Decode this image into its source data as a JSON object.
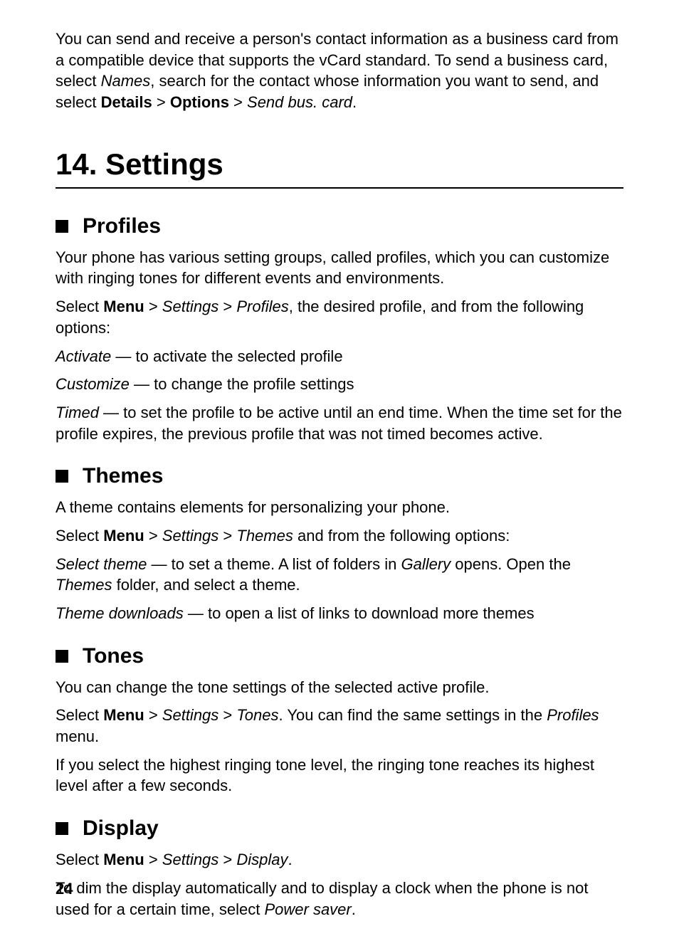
{
  "intro": {
    "text_before_names": "You can send and receive a person's contact information as a business card from a compatible device that supports the vCard standard. To send a business card, select ",
    "names": "Names",
    "text_after_names": ", search for the contact whose information you want to send, and select ",
    "details": "Details",
    "gt1": " > ",
    "options": "Options",
    "gt2": " > ",
    "send_bus_card": "Send bus. card",
    "period": "."
  },
  "chapter": {
    "title": "14. Settings"
  },
  "profiles": {
    "heading": "Profiles",
    "p1": "Your phone has various setting groups, called profiles, which you can customize with ringing tones for different events and environments.",
    "p2_select": "Select ",
    "p2_menu": "Menu",
    "p2_gt1": " > ",
    "p2_settings": "Settings",
    "p2_gt2": " > ",
    "p2_profiles": "Profiles",
    "p2_rest": ", the desired profile, and from the following options:",
    "activate": "Activate",
    "activate_text": " — to activate the selected profile",
    "customize": "Customize",
    "customize_text": " — to change the profile settings",
    "timed": "Timed",
    "timed_text": " — to set the profile to be active until an end time. When the time set for the profile expires, the previous profile that was not timed becomes active."
  },
  "themes": {
    "heading": "Themes",
    "p1": "A theme contains elements for personalizing your phone.",
    "p2_select": "Select ",
    "p2_menu": "Menu",
    "p2_gt1": " > ",
    "p2_settings": "Settings",
    "p2_gt2": " > ",
    "p2_themes": "Themes",
    "p2_rest": " and from the following options:",
    "select_theme": "Select theme",
    "select_theme_text1": " — to set a theme. A list of folders in ",
    "gallery": "Gallery",
    "select_theme_text2": " opens. Open the ",
    "themes_folder": "Themes",
    "select_theme_text3": " folder, and select a theme.",
    "theme_downloads": "Theme downloads",
    "theme_downloads_text": " — to open a list of links to download more themes"
  },
  "tones": {
    "heading": "Tones",
    "p1": "You can change the tone settings of the selected active profile.",
    "p2_select": "Select ",
    "p2_menu": "Menu",
    "p2_gt1": " > ",
    "p2_settings": "Settings",
    "p2_gt2": " > ",
    "p2_tones": "Tones",
    "p2_rest1": ". You can find the same settings in the ",
    "p2_profiles": "Profiles",
    "p2_rest2": " menu.",
    "p3": "If you select the highest ringing tone level, the ringing tone reaches its highest level after a few seconds."
  },
  "display": {
    "heading": "Display",
    "p1_select": "Select ",
    "p1_menu": "Menu",
    "p1_gt1": " > ",
    "p1_settings": "Settings",
    "p1_gt2": " > ",
    "p1_display": "Display",
    "p1_period": ".",
    "p2_text1": "To dim the display automatically and to display a clock when the phone is not used for a certain time, select ",
    "p2_power_saver": "Power saver",
    "p2_period": "."
  },
  "page_number": "24"
}
